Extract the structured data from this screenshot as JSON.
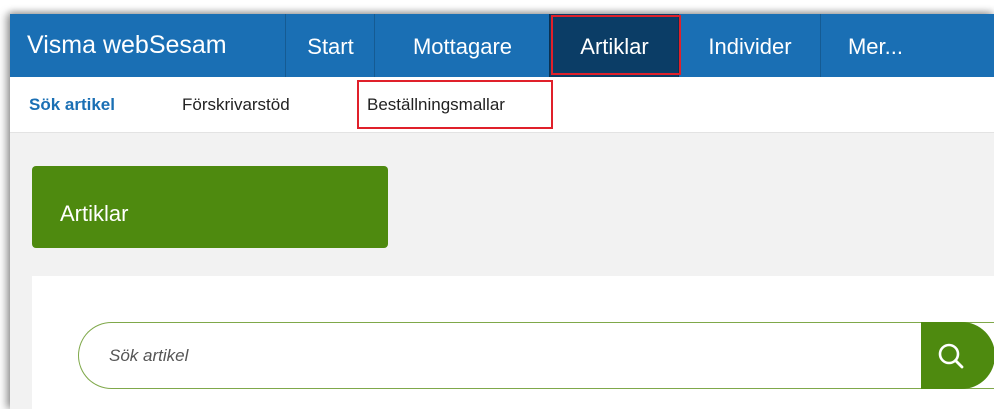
{
  "app": {
    "brand": "Visma webSesam"
  },
  "topnav": {
    "items": [
      {
        "label": "Start"
      },
      {
        "label": "Mottagare"
      },
      {
        "label": "Artiklar",
        "active": true
      },
      {
        "label": "Individer"
      },
      {
        "label": "Mer..."
      }
    ]
  },
  "subnav": {
    "items": [
      {
        "label": "Sök artikel",
        "active": true
      },
      {
        "label": "Förskrivarstöd"
      },
      {
        "label": "Beställningsmallar"
      }
    ]
  },
  "panel": {
    "title": "Artiklar"
  },
  "search": {
    "placeholder": "Sök artikel",
    "value": ""
  },
  "icons": {
    "search_button": "search-icon"
  },
  "colors": {
    "topnav_bg": "#1a6fb4",
    "active_nav": "#0b3d66",
    "accent_green": "#4e8a0f",
    "highlight_red": "#e0202a",
    "subnav_active": "#1a6fb4"
  }
}
